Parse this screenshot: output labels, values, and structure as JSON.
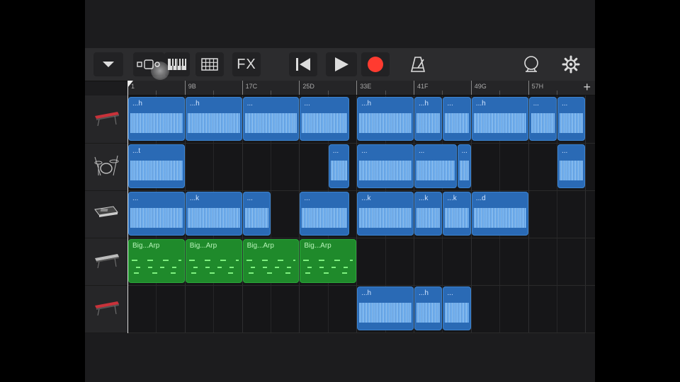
{
  "toolbar": {
    "fx_label": "FX",
    "record_color": "#ff3b30",
    "icons": [
      "chevron-down-icon",
      "tracks-view-icon",
      "keyboard-icon",
      "grid-icon",
      "rewind-icon",
      "play-icon",
      "record-icon",
      "metronome-icon",
      "loop-icon",
      "settings-icon"
    ]
  },
  "ruler": {
    "bars": [
      {
        "label": "1",
        "bar": 1
      },
      {
        "label": "9B",
        "bar": 9
      },
      {
        "label": "17C",
        "bar": 17
      },
      {
        "label": "25D",
        "bar": 25
      },
      {
        "label": "33E",
        "bar": 33
      },
      {
        "label": "41F",
        "bar": 41
      },
      {
        "label": "49G",
        "bar": 49
      },
      {
        "label": "57H",
        "bar": 57
      }
    ],
    "add_label": "+"
  },
  "tracks": [
    {
      "icon": "synth-keyboard-icon",
      "color": "#c8323a"
    },
    {
      "icon": "drum-kit-icon",
      "color": "#bbbbbb"
    },
    {
      "icon": "sampler-keyboard-icon",
      "color": "#cccccc"
    },
    {
      "icon": "synth-keyboard-icon",
      "color": "#bbbbbb"
    },
    {
      "icon": "synth-keyboard-icon",
      "color": "#c8323a"
    }
  ],
  "regions": [
    {
      "track": 0,
      "type": "audio",
      "start": 1,
      "end": 9,
      "name": "...h"
    },
    {
      "track": 0,
      "type": "audio",
      "start": 9,
      "end": 17,
      "name": "...h"
    },
    {
      "track": 0,
      "type": "audio",
      "start": 17,
      "end": 25,
      "name": "..."
    },
    {
      "track": 0,
      "type": "audio",
      "start": 25,
      "end": 32,
      "name": "..."
    },
    {
      "track": 0,
      "type": "audio",
      "start": 33,
      "end": 41,
      "name": "...h"
    },
    {
      "track": 0,
      "type": "audio",
      "start": 41,
      "end": 45,
      "name": "...h"
    },
    {
      "track": 0,
      "type": "audio",
      "start": 45,
      "end": 49,
      "name": "..."
    },
    {
      "track": 0,
      "type": "audio",
      "start": 49,
      "end": 57,
      "name": "...h"
    },
    {
      "track": 0,
      "type": "audio",
      "start": 57,
      "end": 61,
      "name": "..."
    },
    {
      "track": 0,
      "type": "audio",
      "start": 61,
      "end": 65,
      "name": "..."
    },
    {
      "track": 1,
      "type": "audio",
      "start": 1,
      "end": 9,
      "name": "...t"
    },
    {
      "track": 1,
      "type": "audio",
      "start": 29,
      "end": 32,
      "name": "..."
    },
    {
      "track": 1,
      "type": "audio",
      "start": 33,
      "end": 41,
      "name": "..."
    },
    {
      "track": 1,
      "type": "audio",
      "start": 41,
      "end": 47,
      "name": "..."
    },
    {
      "track": 1,
      "type": "audio",
      "start": 47,
      "end": 49,
      "name": "..."
    },
    {
      "track": 1,
      "type": "audio",
      "start": 61,
      "end": 65,
      "name": "..."
    },
    {
      "track": 2,
      "type": "audio",
      "start": 1,
      "end": 9,
      "name": "..."
    },
    {
      "track": 2,
      "type": "audio",
      "start": 9,
      "end": 17,
      "name": "...k"
    },
    {
      "track": 2,
      "type": "audio",
      "start": 17,
      "end": 21,
      "name": "..."
    },
    {
      "track": 2,
      "type": "audio",
      "start": 25,
      "end": 32,
      "name": "..."
    },
    {
      "track": 2,
      "type": "audio",
      "start": 33,
      "end": 41,
      "name": "...k"
    },
    {
      "track": 2,
      "type": "audio",
      "start": 41,
      "end": 45,
      "name": "...k"
    },
    {
      "track": 2,
      "type": "audio",
      "start": 45,
      "end": 49,
      "name": "...k"
    },
    {
      "track": 2,
      "type": "audio",
      "start": 49,
      "end": 57,
      "name": "...d"
    },
    {
      "track": 3,
      "type": "midi",
      "start": 1,
      "end": 9,
      "name": "Big...Arp"
    },
    {
      "track": 3,
      "type": "midi",
      "start": 9,
      "end": 17,
      "name": "Big...Arp"
    },
    {
      "track": 3,
      "type": "midi",
      "start": 17,
      "end": 25,
      "name": "Big...Arp"
    },
    {
      "track": 3,
      "type": "midi",
      "start": 25,
      "end": 33,
      "name": "Big...Arp"
    },
    {
      "track": 4,
      "type": "audio",
      "start": 33,
      "end": 41,
      "name": "...h"
    },
    {
      "track": 4,
      "type": "audio",
      "start": 41,
      "end": 45,
      "name": "...h"
    },
    {
      "track": 4,
      "type": "audio",
      "start": 45,
      "end": 49,
      "name": "..."
    }
  ]
}
